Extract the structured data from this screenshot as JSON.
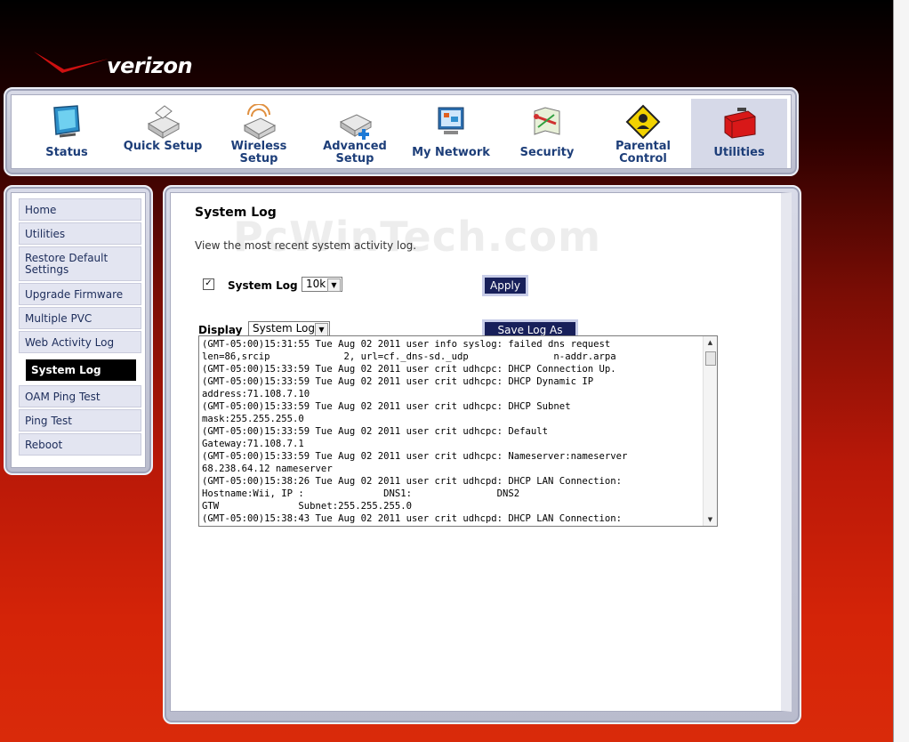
{
  "brand": {
    "name": "verizon"
  },
  "nav": {
    "items": [
      {
        "label": "Status",
        "icon": "status-monitor-icon"
      },
      {
        "label": "Quick Setup",
        "icon": "router-setup-icon"
      },
      {
        "label": "Wireless Setup",
        "icon": "wireless-router-icon"
      },
      {
        "label": "Advanced Setup",
        "icon": "advanced-router-icon"
      },
      {
        "label": "My Network",
        "icon": "network-computer-icon"
      },
      {
        "label": "Security",
        "icon": "security-map-icon"
      },
      {
        "label": "Parental Control",
        "icon": "warning-sign-icon"
      },
      {
        "label": "Utilities",
        "icon": "toolbox-icon"
      }
    ],
    "active": "Utilities"
  },
  "sidebar": {
    "items": [
      {
        "label": "Home"
      },
      {
        "label": "Utilities"
      },
      {
        "label": "Restore Default Settings"
      },
      {
        "label": "Upgrade Firmware"
      },
      {
        "label": "Multiple PVC"
      },
      {
        "label": "Web Activity Log"
      },
      {
        "label": "System Log"
      },
      {
        "label": "OAM Ping Test"
      },
      {
        "label": "Ping Test"
      },
      {
        "label": "Reboot"
      }
    ],
    "active": "System Log"
  },
  "main": {
    "title": "System Log",
    "description": "View the most recent system activity log.",
    "watermark": "PcWinTech.com",
    "syslog_checkbox_label": "System Log",
    "syslog_checked": true,
    "size_select_value": "10k",
    "apply_label": "Apply",
    "display_label": "Display",
    "display_select_value": "System Log",
    "save_label": "Save Log As",
    "log_lines": [
      "(GMT-05:00)15:31:55 Tue Aug 02 2011 user info syslog: failed dns request",
      "len=86,srcip             2, url=cf._dns-sd._udp               n-addr.arpa",
      "(GMT-05:00)15:33:59 Tue Aug 02 2011 user crit udhcpc: DHCP Connection Up.",
      "(GMT-05:00)15:33:59 Tue Aug 02 2011 user crit udhcpc: DHCP Dynamic IP",
      "address:71.108.7.10",
      "(GMT-05:00)15:33:59 Tue Aug 02 2011 user crit udhcpc: DHCP Subnet",
      "mask:255.255.255.0",
      "(GMT-05:00)15:33:59 Tue Aug 02 2011 user crit udhcpc: Default",
      "Gateway:71.108.7.1",
      "(GMT-05:00)15:33:59 Tue Aug 02 2011 user crit udhcpc: Nameserver:nameserver",
      "68.238.64.12 nameserver",
      "(GMT-05:00)15:38:26 Tue Aug 02 2011 user crit udhcpd: DHCP LAN Connection:",
      "Hostname:Wii, IP :              DNS1:               DNS2",
      "GTW              Subnet:255.255.255.0",
      "(GMT-05:00)15:38:43 Tue Aug 02 2011 user crit udhcpd: DHCP LAN Connection:"
    ]
  }
}
